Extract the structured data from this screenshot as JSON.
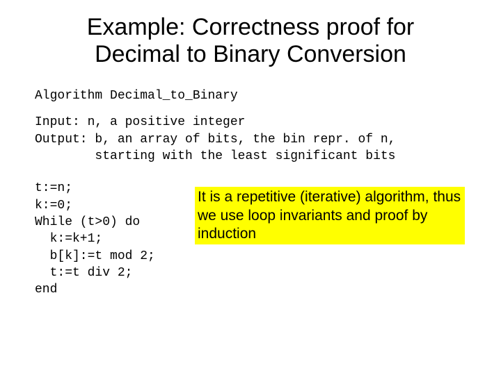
{
  "title_line1": "Example: Correctness proof for",
  "title_line2": "Decimal to Binary Conversion",
  "alg_header": "Algorithm Decimal_to_Binary",
  "io_block": "Input: n, a positive integer\nOutput: b, an array of bits, the bin repr. of n,\n        starting with the least significant bits",
  "code_block": "t:=n;\nk:=0;\nWhile (t>0) do\n  k:=k+1;\n  b[k]:=t mod 2;\n  t:=t div 2;\nend",
  "callout_text": "It is a repetitive (iterative) algorithm, thus we use loop invariants and proof by induction"
}
